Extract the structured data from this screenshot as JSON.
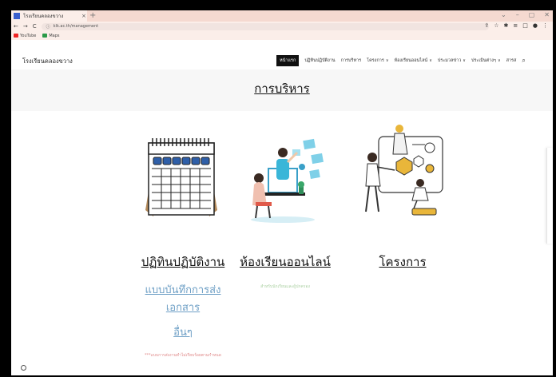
{
  "browser": {
    "tab_title": "โรงเรียนคลองขวาง",
    "tab_close": "×",
    "new_tab": "+",
    "url": "klk.ac.th/management",
    "bookmarks": [
      {
        "label": "YouTube",
        "icon": "youtube-icon"
      },
      {
        "label": "Maps",
        "icon": "maps-icon"
      }
    ]
  },
  "site": {
    "name": "โรงเรียนคลองขวาง",
    "menu": [
      {
        "label": "หน้าแรก",
        "active": true,
        "dropdown": false
      },
      {
        "label": "ปฏิทินปฏิบัติงาน",
        "active": false,
        "dropdown": false
      },
      {
        "label": "การบริหาร",
        "active": false,
        "dropdown": false
      },
      {
        "label": "โครงการ",
        "active": false,
        "dropdown": true
      },
      {
        "label": "ห้องเรียนออนไลน์",
        "active": false,
        "dropdown": true
      },
      {
        "label": "ประมวลข่าว",
        "active": false,
        "dropdown": true
      },
      {
        "label": "ประเมินต่างๆ",
        "active": false,
        "dropdown": true
      },
      {
        "label": "สารส",
        "active": false,
        "dropdown": false
      }
    ]
  },
  "page": {
    "title": "การบริหาร"
  },
  "columns": {
    "calendar": {
      "title": "ปฏิทินปฏิบัติงาน",
      "link1": "แบบบันทึกการส่ง",
      "link2": "เอกสาร",
      "link3": "อื่นๆ",
      "note": "***แบบการส่งงานทำไม่เรียบร้อยตามกำหนด"
    },
    "online": {
      "title": "ห้องเรียนออนไลน์",
      "note": "สำหรับนักเรียนและผู้ปกครอง"
    },
    "project": {
      "title": "โครงการ"
    }
  },
  "colors": {
    "link": "#6fa0c6",
    "note_red": "#e08a8a",
    "note_green": "#a9cfa0",
    "tabbar": "#f5d9d0",
    "accent": "#111111"
  }
}
